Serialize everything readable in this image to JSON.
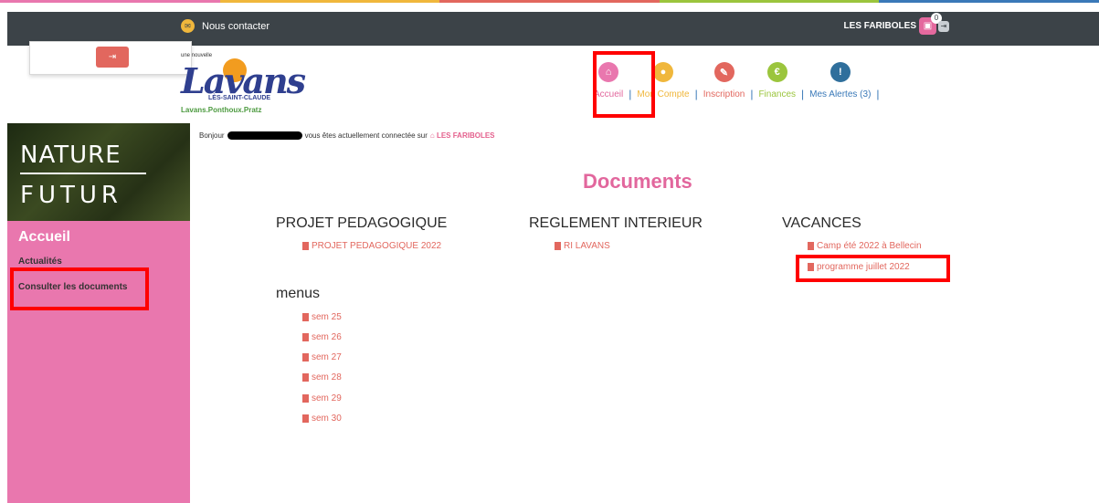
{
  "colors": {
    "accent_pink": "#e977ae",
    "topbar": "#3c4348",
    "file_red": "#e2675e"
  },
  "topbar": {
    "contact_label": "Nous contacter",
    "org_name": "LES FARIBOLES",
    "cart_count": "0"
  },
  "logo": {
    "prefix": "une nouvelle",
    "name": "Lavans",
    "subtitle": "LÈS-SAINT-CLAUDE",
    "towns": "Lavans.Ponthoux.Pratz"
  },
  "nav": {
    "accueil": "Accueil",
    "compte": "Mon Compte",
    "inscription": "Inscription",
    "finances": "Finances",
    "alertes": "Mes Alertes (3)"
  },
  "sidebar": {
    "banner_line1": "NATURE",
    "banner_line2": "FUTUR",
    "title": "Accueil",
    "actualites": "Actualités",
    "documents": "Consulter les documents"
  },
  "greeting": {
    "before": "Bonjour",
    "after": "vous êtes actuellement connectée sur",
    "link": "LES FARIBOLES"
  },
  "main": {
    "title": "Documents",
    "sections": [
      {
        "title": "PROJET PEDAGOGIQUE",
        "files": [
          "PROJET PEDAGOGIQUE 2022"
        ]
      },
      {
        "title": "REGLEMENT INTERIEUR",
        "files": [
          "RI LAVANS"
        ]
      },
      {
        "title": "VACANCES",
        "files": [
          "Camp été 2022 à Bellecin",
          "programme juillet 2022"
        ]
      },
      {
        "title": "menus",
        "files": [
          "sem 25",
          "sem 26",
          "sem 27",
          "sem 28",
          "sem 29",
          "sem 30"
        ]
      }
    ]
  }
}
